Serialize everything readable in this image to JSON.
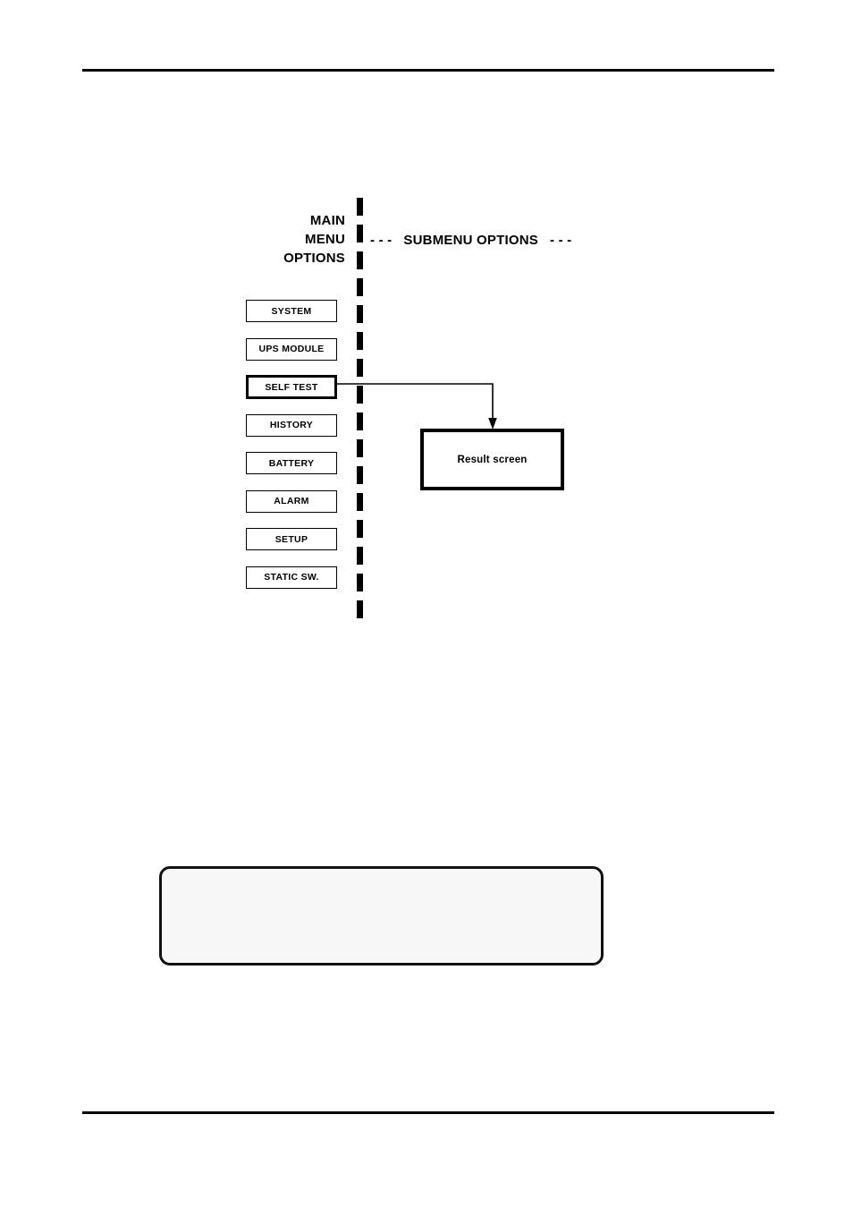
{
  "page": {
    "background_color": "#ffffff",
    "rule_color": "#000000"
  },
  "diagram": {
    "type": "menu-navigation-flow",
    "main_menu_heading": "MAIN\nMENU\nOPTIONS",
    "submenu_heading": "- - -   SUBMENU OPTIONS   - - -",
    "divider": {
      "style": "dashed-vertical",
      "dash_count": 16,
      "color": "#000000"
    },
    "menu_items": [
      {
        "label": "SYSTEM",
        "selected": false
      },
      {
        "label": "UPS MODULE",
        "selected": false
      },
      {
        "label": "SELF TEST",
        "selected": true
      },
      {
        "label": "HISTORY",
        "selected": false
      },
      {
        "label": "BATTERY",
        "selected": false
      },
      {
        "label": "ALARM",
        "selected": false
      },
      {
        "label": "SETUP",
        "selected": false
      },
      {
        "label": "STATIC SW.",
        "selected": false
      }
    ],
    "submenu_nodes": [
      {
        "label": "Result screen",
        "from": "SELF TEST"
      }
    ],
    "connector": {
      "from": "SELF TEST",
      "to": "Result screen",
      "arrowhead": "down"
    }
  },
  "note": {
    "text": ""
  }
}
